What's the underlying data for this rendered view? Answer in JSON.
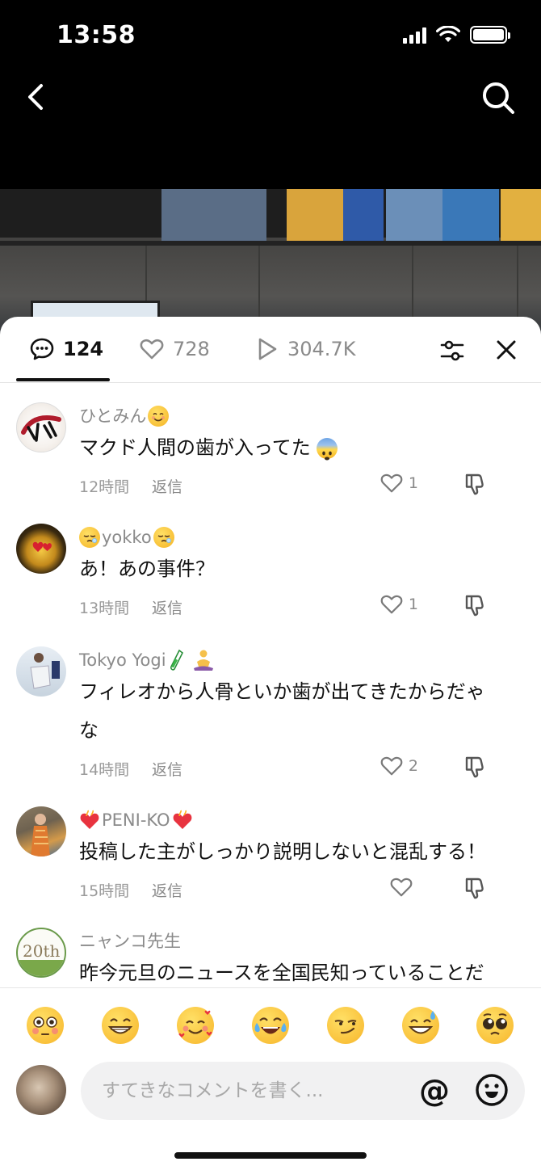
{
  "status_bar": {
    "time": "13:58"
  },
  "nav": {
    "back_icon": "chevron-left-icon",
    "search_icon": "search-icon"
  },
  "tabs": {
    "comments_count": "124",
    "likes_count": "728",
    "plays_count": "304.7K"
  },
  "comments": [
    {
      "name": "ひとみん",
      "name_emoji": "smiling-face-icon",
      "text": "マクド人間の歯が入ってた",
      "text_emoji": "anxious-face-icon",
      "time": "12時間",
      "reply": "返信",
      "likes": "1"
    },
    {
      "name": "yokko",
      "name_emoji": "sleepy-face-icon",
      "text": "あ！あの事件？",
      "time": "13時間",
      "reply": "返信",
      "likes": "1"
    },
    {
      "name": "Tokyo Yogi",
      "name_emoji": "test-tube-meditation-icon",
      "text": "フィレオから人骨といか歯が出てきたからだゃな",
      "time": "14時間",
      "reply": "返信",
      "likes": "2"
    },
    {
      "name": "PENI-KO",
      "name_emoji": "heart-on-fire-icon",
      "text": "投稿した主がしっかり説明しないと混乱する！",
      "time": "15時間",
      "reply": "返信",
      "likes": ""
    },
    {
      "name": "ニャンコ先生",
      "text": "昨今元旦のニュースを全国民知っていることだ",
      "time": "",
      "reply": "",
      "likes": ""
    }
  ],
  "emoji_bar": [
    "flushed-face",
    "grinning-face",
    "smiling-face-with-hearts",
    "tears-of-joy",
    "smirking-face",
    "grinning-sweat",
    "pleading-face"
  ],
  "input": {
    "placeholder": "すてきなコメントを書く...",
    "at_label": "@"
  },
  "colors": {
    "accent_text": "#111111",
    "muted_text": "#8a8a8a",
    "sheet_bg": "#ffffff",
    "chrome_bg": "#000000"
  }
}
